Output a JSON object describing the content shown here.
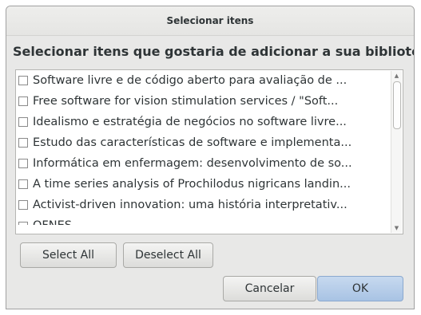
{
  "dialog": {
    "title": "Selecionar itens",
    "heading": "Selecionar itens que gostaria de adicionar a sua biblioteca"
  },
  "items": [
    {
      "label": "Software livre e de código aberto para avaliação de ...",
      "checked": false
    },
    {
      "label": "Free software for vision stimulation services /  \"Soft...",
      "checked": false
    },
    {
      "label": "Idealismo e estratégia de negócios no software livre...",
      "checked": false
    },
    {
      "label": "Estudo das características de software e implementa...",
      "checked": false
    },
    {
      "label": "Informática em enfermagem: desenvolvimento de so...",
      "checked": false
    },
    {
      "label": "A time series analysis of Prochilodus nigricans landin...",
      "checked": false
    },
    {
      "label": "Activist-driven innovation: uma história interpretativ...",
      "checked": false
    },
    {
      "label": "OFNES ...",
      "checked": false
    }
  ],
  "buttons": {
    "select_all": "Select All",
    "deselect_all": "Deselect All",
    "cancel": "Cancelar",
    "ok": "OK"
  },
  "scrollbar": {
    "up_icon": "arrow-up-icon",
    "down_icon": "arrow-down-icon",
    "up_glyph": "▲",
    "down_glyph": "▼"
  }
}
